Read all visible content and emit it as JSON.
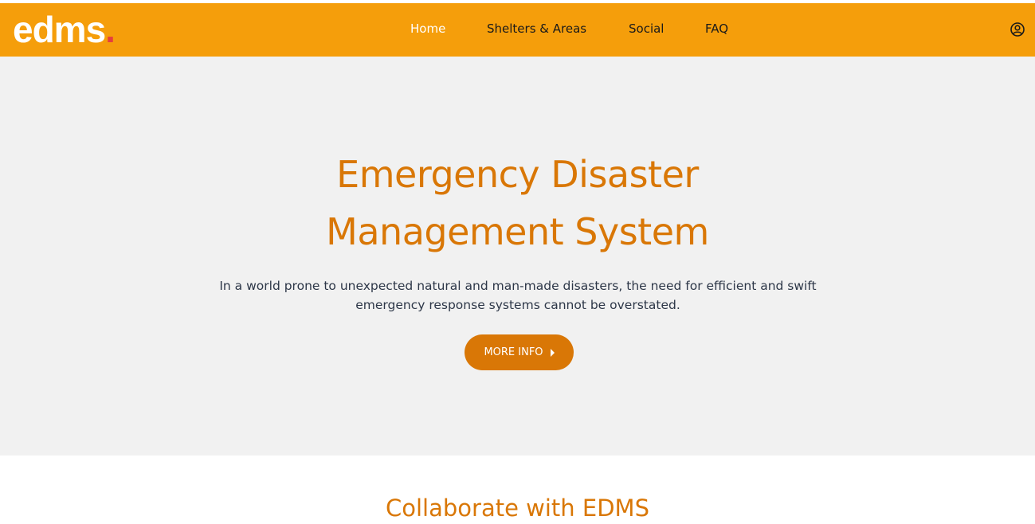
{
  "header": {
    "logo_text": "edms",
    "logo_dot": ".",
    "nav": [
      {
        "label": "Home",
        "active": true
      },
      {
        "label": "Shelters & Areas",
        "active": false
      },
      {
        "label": "Social",
        "active": false
      },
      {
        "label": "FAQ",
        "active": false
      }
    ],
    "user_icon": "user-circle-icon"
  },
  "hero": {
    "title_line1": "Emergency Disaster",
    "title_line2": "Management System",
    "description": "In a world prone to unexpected natural and man-made disasters, the need for efficient and swift emergency response systems cannot be overstated.",
    "button_label": "MORE INFO",
    "button_icon": "caret-right-icon"
  },
  "section": {
    "title": "Collaborate with EDMS"
  },
  "colors": {
    "header_bg": "#f59e0b",
    "accent": "#d97706",
    "logo_dot": "#e53e3e",
    "hero_bg": "#f1f1f1"
  }
}
